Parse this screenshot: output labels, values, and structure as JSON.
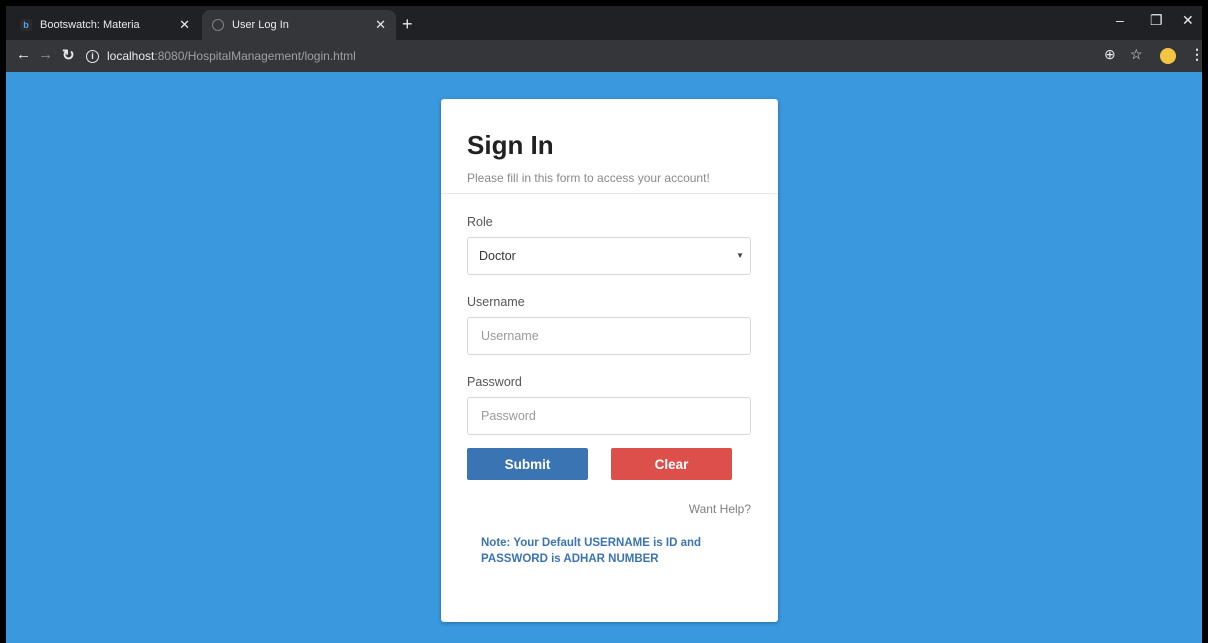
{
  "browser": {
    "tabs": [
      {
        "title": "Bootswatch: Materia",
        "favicon": "bootswatch-icon"
      },
      {
        "title": "User Log In",
        "favicon": "globe-icon"
      }
    ],
    "url_host": "localhost",
    "url_path": ":8080/HospitalManagement/login.html"
  },
  "form": {
    "title": "Sign In",
    "subtitle": "Please fill in this form to access your account!",
    "role_label": "Role",
    "role_value": "Doctor",
    "username_label": "Username",
    "username_placeholder": "Username",
    "password_label": "Password",
    "password_placeholder": "Password",
    "submit_label": "Submit",
    "clear_label": "Clear",
    "help_text": "Want Help?",
    "note": "Note: Your Default USERNAME is ID and PASSWORD is ADHAR NUMBER"
  },
  "colors": {
    "page_background": "#3a98de",
    "submit": "#3a74b3",
    "clear": "#dc4f4a",
    "note": "#3a74b3"
  }
}
